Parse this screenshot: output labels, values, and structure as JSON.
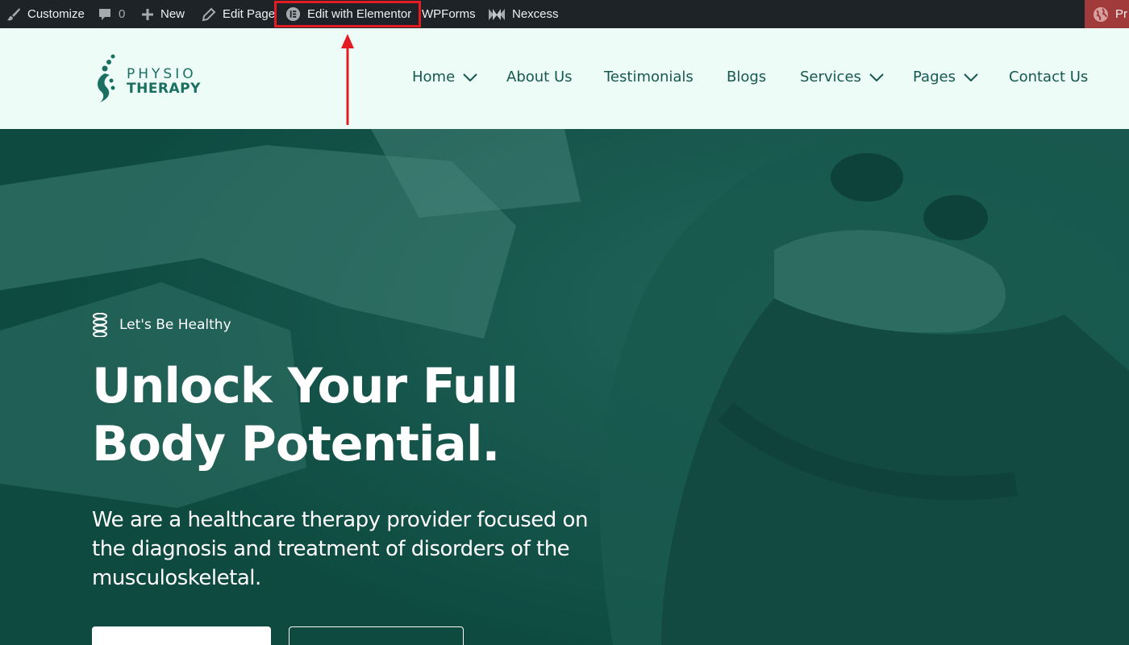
{
  "admin_bar": {
    "customize": "Customize",
    "comments_count": "0",
    "new": "New",
    "edit_page": "Edit Page",
    "edit_with_elementor": "Edit with Elementor",
    "wpforms": "WPForms",
    "nexcess": "Nexcess",
    "right_item": "Pr"
  },
  "site": {
    "logo_line1": "PHYSIO",
    "logo_line2": "THERAPY",
    "nav": [
      {
        "label": "Home",
        "has_dropdown": true
      },
      {
        "label": "About Us",
        "has_dropdown": false
      },
      {
        "label": "Testimonials",
        "has_dropdown": false
      },
      {
        "label": "Blogs",
        "has_dropdown": false
      },
      {
        "label": "Services",
        "has_dropdown": true
      },
      {
        "label": "Pages",
        "has_dropdown": true
      },
      {
        "label": "Contact Us",
        "has_dropdown": false
      }
    ]
  },
  "hero": {
    "tag": "Let's Be Healthy",
    "title": "Unlock Your Full Body Potential.",
    "description": "We are a healthcare therapy provider focused on the diagnosis and treatment of disorders of the musculoskeletal."
  },
  "colors": {
    "admin_bar_bg": "#1d2327",
    "highlight": "#e31b23",
    "header_bg": "#eefcf8",
    "brand_green": "#1a6f61",
    "hero_overlay": "#0d4a40"
  },
  "icons": {
    "customize": "brush-icon",
    "comments": "comment-icon",
    "new": "plus-icon",
    "edit": "pencil-icon",
    "elementor": "elementor-icon",
    "nexcess": "nexcess-icon",
    "right": "globe-icon",
    "tag": "spine-icon",
    "dropdown": "chevron-down-icon"
  }
}
